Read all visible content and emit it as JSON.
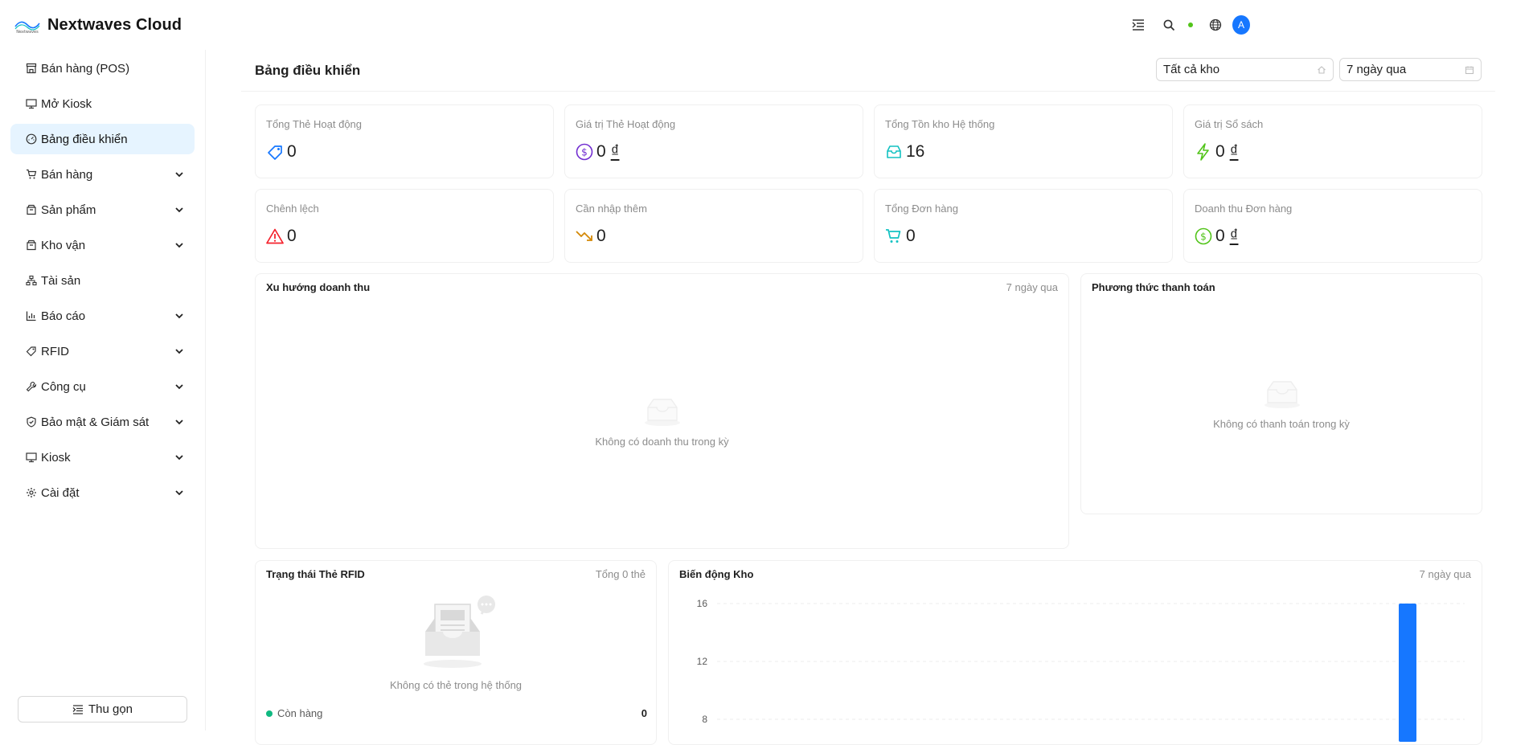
{
  "app": {
    "name": "Nextwaves Cloud",
    "logo_text": "Nextwaves"
  },
  "header": {
    "avatar_letter": "A",
    "status_color": "#52c41a",
    "accent": "#1677ff"
  },
  "sidebar": {
    "items": [
      {
        "label": "Bán hàng (POS)",
        "icon": "store-icon",
        "has_children": false,
        "active": false
      },
      {
        "label": "Mở Kiosk",
        "icon": "monitor-icon",
        "has_children": false,
        "active": false
      },
      {
        "label": "Bảng điều khiển",
        "icon": "dashboard-icon",
        "has_children": false,
        "active": true
      },
      {
        "label": "Bán hàng",
        "icon": "cart-icon",
        "has_children": true,
        "active": false
      },
      {
        "label": "Sản phẩm",
        "icon": "package-icon",
        "has_children": true,
        "active": false
      },
      {
        "label": "Kho vận",
        "icon": "warehouse-icon",
        "has_children": true,
        "active": false
      },
      {
        "label": "Tài sản",
        "icon": "hierarchy-icon",
        "has_children": false,
        "active": false
      },
      {
        "label": "Báo cáo",
        "icon": "bar-chart-icon",
        "has_children": true,
        "active": false
      },
      {
        "label": "RFID",
        "icon": "tag-icon",
        "has_children": true,
        "active": false
      },
      {
        "label": "Công cụ",
        "icon": "wrench-icon",
        "has_children": true,
        "active": false
      },
      {
        "label": "Bảo mật & Giám sát",
        "icon": "shield-icon",
        "has_children": true,
        "active": false
      },
      {
        "label": "Kiosk",
        "icon": "monitor-icon",
        "has_children": true,
        "active": false
      },
      {
        "label": "Cài đặt",
        "icon": "gear-icon",
        "has_children": true,
        "active": false
      }
    ],
    "collapse_label": "Thu gọn"
  },
  "page": {
    "title": "Bảng điều khiển",
    "warehouse_select": "Tất cả kho",
    "period_select": "7 ngày qua"
  },
  "stats": [
    {
      "label": "Tổng Thẻ Hoạt động",
      "value": "0",
      "currency": "",
      "icon": "tag-icon",
      "color": "#1677ff"
    },
    {
      "label": "Giá trị Thẻ Hoạt động",
      "value": "0",
      "currency": "₫",
      "icon": "dollar-circle-icon",
      "color": "#722ed1"
    },
    {
      "label": "Tổng Tồn kho Hệ thống",
      "value": "16",
      "currency": "",
      "icon": "inbox-icon",
      "color": "#13c2c2"
    },
    {
      "label": "Giá trị Sổ sách",
      "value": "0",
      "currency": "₫",
      "icon": "lightning-icon",
      "color": "#52c41a"
    },
    {
      "label": "Chênh lệch",
      "value": "0",
      "currency": "",
      "icon": "warning-icon",
      "color": "#f5222d"
    },
    {
      "label": "Cần nhập thêm",
      "value": "0",
      "currency": "",
      "icon": "trend-down-icon",
      "color": "#d48806"
    },
    {
      "label": "Tổng Đơn hàng",
      "value": "0",
      "currency": "",
      "icon": "cart-icon",
      "color": "#13c2c2"
    },
    {
      "label": "Doanh thu Đơn hàng",
      "value": "0",
      "currency": "₫",
      "icon": "dollar-circle-icon",
      "color": "#52c41a"
    }
  ],
  "revenue_card": {
    "title": "Xu hướng doanh thu",
    "extra": "7 ngày qua",
    "empty": "Không có doanh thu trong kỳ"
  },
  "payment_card": {
    "title": "Phương thức thanh toán",
    "empty": "Không có thanh toán trong kỳ"
  },
  "rfid_card": {
    "title": "Trạng thái Thẻ RFID",
    "extra": "Tổng 0 thẻ",
    "empty": "Không có thẻ trong hệ thống",
    "legend": [
      {
        "label": "Còn hàng",
        "count": "0",
        "color": "#10b981"
      }
    ]
  },
  "stock_card": {
    "title": "Biến động Kho",
    "extra": "7 ngày qua"
  },
  "chart_data": {
    "type": "bar",
    "y_ticks": [
      16,
      12,
      8
    ],
    "ylim": [
      0,
      16
    ],
    "visible_bars": [
      {
        "value": 16,
        "color": "#1677ff"
      }
    ],
    "grid": true,
    "title": "Biến động Kho"
  }
}
